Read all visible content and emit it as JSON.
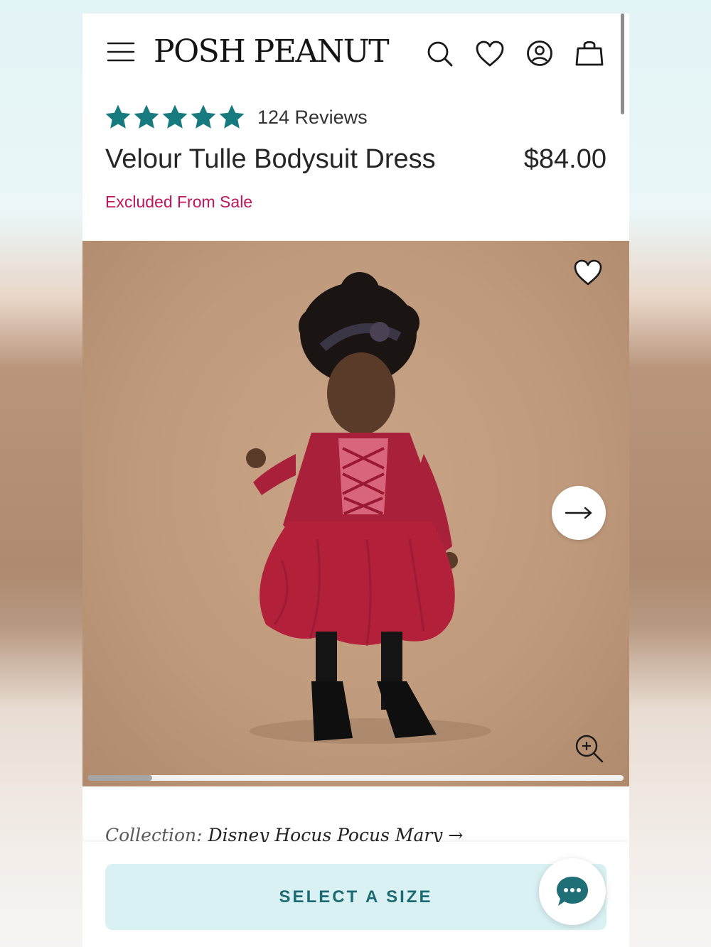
{
  "header": {
    "logo": "POSH PEANUT",
    "icons": [
      "menu-icon",
      "search-icon",
      "heart-icon",
      "account-icon",
      "bag-icon"
    ]
  },
  "product": {
    "rating": 5,
    "reviews_label": "124 Reviews",
    "title": "Velour Tulle Bodysuit Dress",
    "price": "$84.00",
    "sale_note": "Excluded From Sale",
    "gallery_progress": 0.12
  },
  "collection": {
    "label": "Collection:",
    "value": "Disney Hocus Pocus Mary →"
  },
  "cta": {
    "select_size": "SELECT A SIZE"
  },
  "colors": {
    "star": "#177a7f",
    "sale_text": "#c0155b",
    "cta_bg": "#d9f1f3",
    "cta_text": "#1d6b72",
    "chat_icon": "#1f6f77"
  }
}
